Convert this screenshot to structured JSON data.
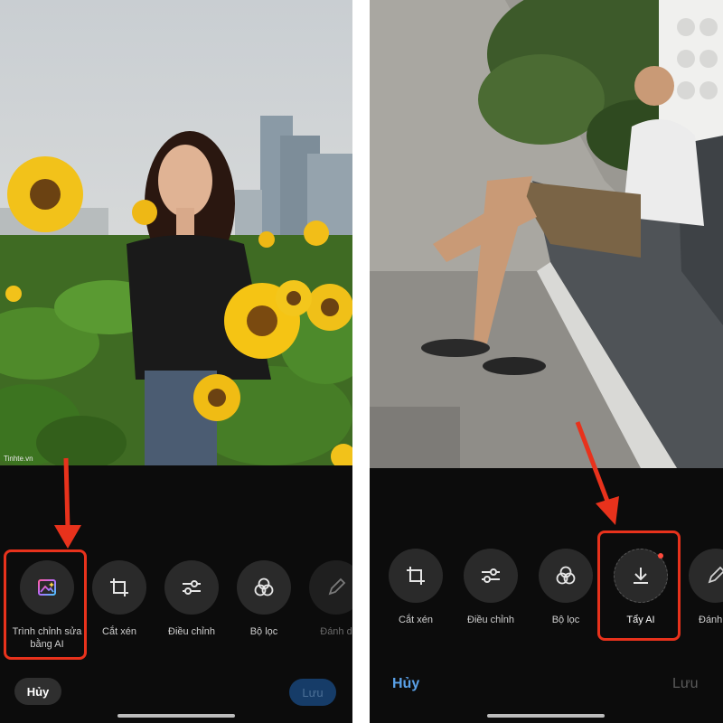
{
  "left_screen": {
    "watermark": "Tinhte.vn",
    "tools": [
      {
        "label": "Trình chỉnh sửa bằng AI",
        "icon": "ai-editor-icon"
      },
      {
        "label": "Cắt xén",
        "icon": "crop-icon"
      },
      {
        "label": "Điều chỉnh",
        "icon": "adjust-sliders-icon"
      },
      {
        "label": "Bộ lọc",
        "icon": "filters-icon"
      },
      {
        "label": "Đánh d",
        "icon": "markup-pen-icon"
      }
    ],
    "cancel_label": "Hủy",
    "save_label": "Lưu"
  },
  "right_screen": {
    "tools": [
      {
        "label": "Cắt xén",
        "icon": "crop-icon"
      },
      {
        "label": "Điều chỉnh",
        "icon": "adjust-sliders-icon"
      },
      {
        "label": "Bộ lọc",
        "icon": "filters-icon"
      },
      {
        "label": "Tẩy AI",
        "icon": "download-icon"
      },
      {
        "label": "Đánh",
        "icon": "markup-pen-icon"
      }
    ],
    "cancel_label": "Hủy",
    "save_label": "Lưu"
  },
  "colors": {
    "highlight": "#e8321c",
    "accent_blue": "#5aa1e8",
    "background": "#0c0c0c"
  }
}
